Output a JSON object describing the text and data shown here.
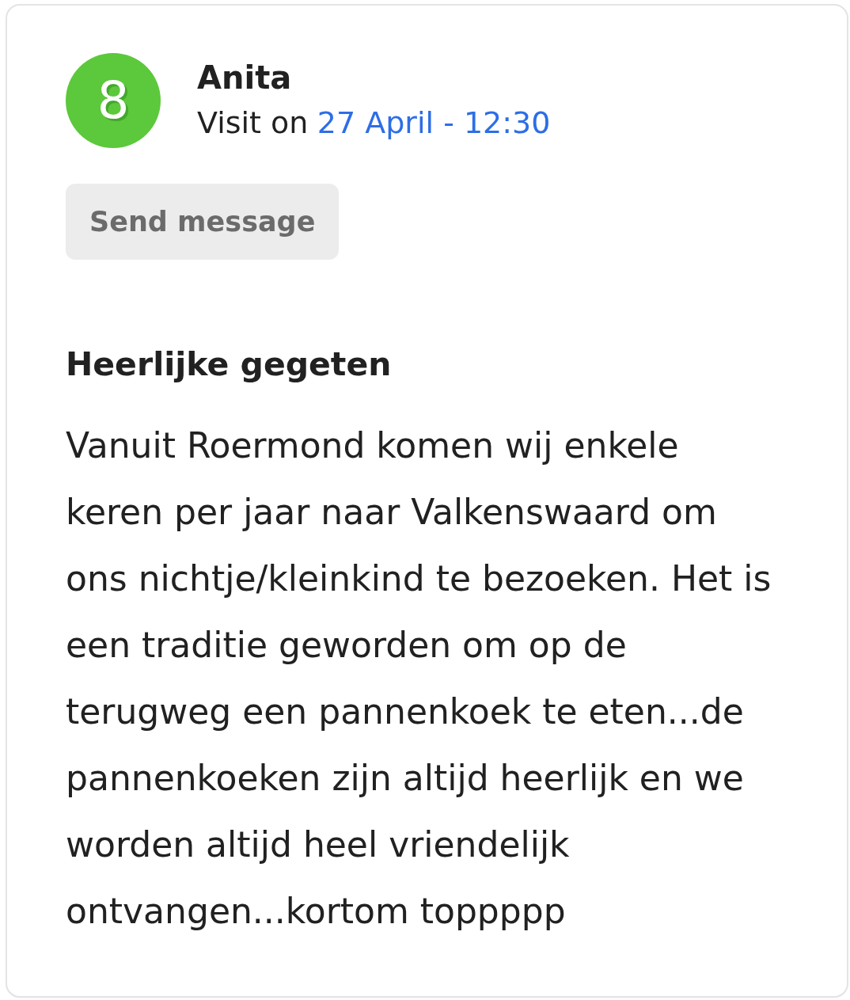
{
  "review": {
    "score": "8",
    "reviewer": "Anita",
    "visit_label": "Visit on",
    "visit_date": "27 April - 12:30"
  },
  "buttons": [
    "Send message"
  ],
  "content": {
    "title": "Heerlijke gegeten",
    "text": "Vanuit Roermond komen wij enkele keren per jaar naar Valkenswaard om ons nichtje/kleinkind te bezoeken. Het is een traditie geworden om op de terugweg een pannenkoek te eten...de pannenkoeken zijn altijd heerlijk en we worden altijd heel vriendelijk ontvangen...kortom toppppp"
  }
}
